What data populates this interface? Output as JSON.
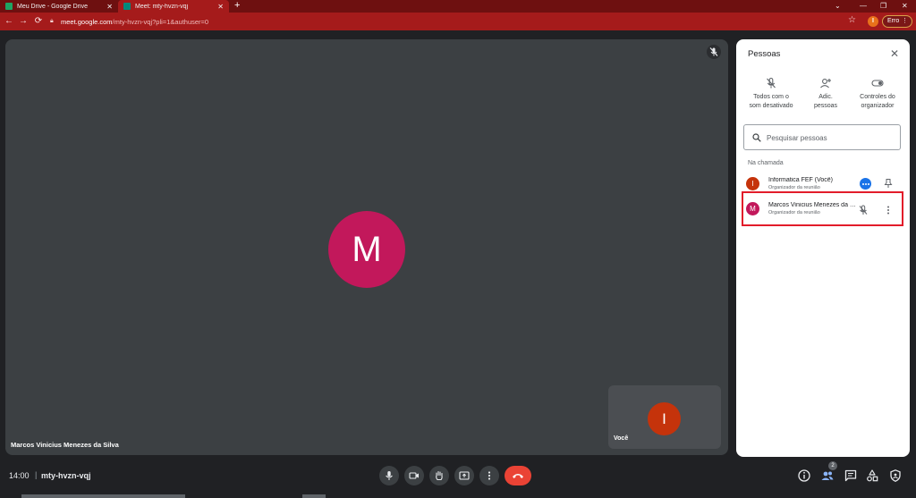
{
  "browser": {
    "tabs": [
      {
        "title": "Meu Drive - Google Drive",
        "favicon_color": "#1fa463"
      },
      {
        "title": "Meet: mty-hvzn-vqj",
        "favicon_color": "#00897b"
      }
    ],
    "url_host": "meet.google.com",
    "url_path": "/mty-hvzn-vqj?pli=1&authuser=0",
    "profile_initial": "I",
    "error_label": "Erro"
  },
  "stage": {
    "main_avatar_initial": "M",
    "main_name": "Marcos Vinicius Menezes da Silva",
    "self_avatar_initial": "I",
    "self_label": "Você"
  },
  "panel": {
    "title": "Pessoas",
    "actions": [
      {
        "label_line1": "Todos com o",
        "label_line2": "som desativado",
        "icon": "mic-off-icon"
      },
      {
        "label_line1": "Adic.",
        "label_line2": "pessoas",
        "icon": "add-person-icon"
      },
      {
        "label_line1": "Controles do",
        "label_line2": "organizador",
        "icon": "toggle-icon"
      }
    ],
    "search_placeholder": "Pesquisar pessoas",
    "section_label": "Na chamada",
    "people": [
      {
        "initial": "I",
        "name": "Informatica FEF (Você)",
        "role": "Organizador da reunião",
        "color": "#c5330b"
      },
      {
        "initial": "M",
        "name": "Marcos Vinicius Menezes da Silva",
        "role": "Organizador da reunião",
        "color": "#c2185b"
      }
    ],
    "highlight_color": "#e21c2a"
  },
  "bottom": {
    "time": "14:00",
    "separator": "|",
    "meeting_code": "mty-hvzn-vqj",
    "participants_count": "2",
    "end_call_color": "#ea4335"
  }
}
